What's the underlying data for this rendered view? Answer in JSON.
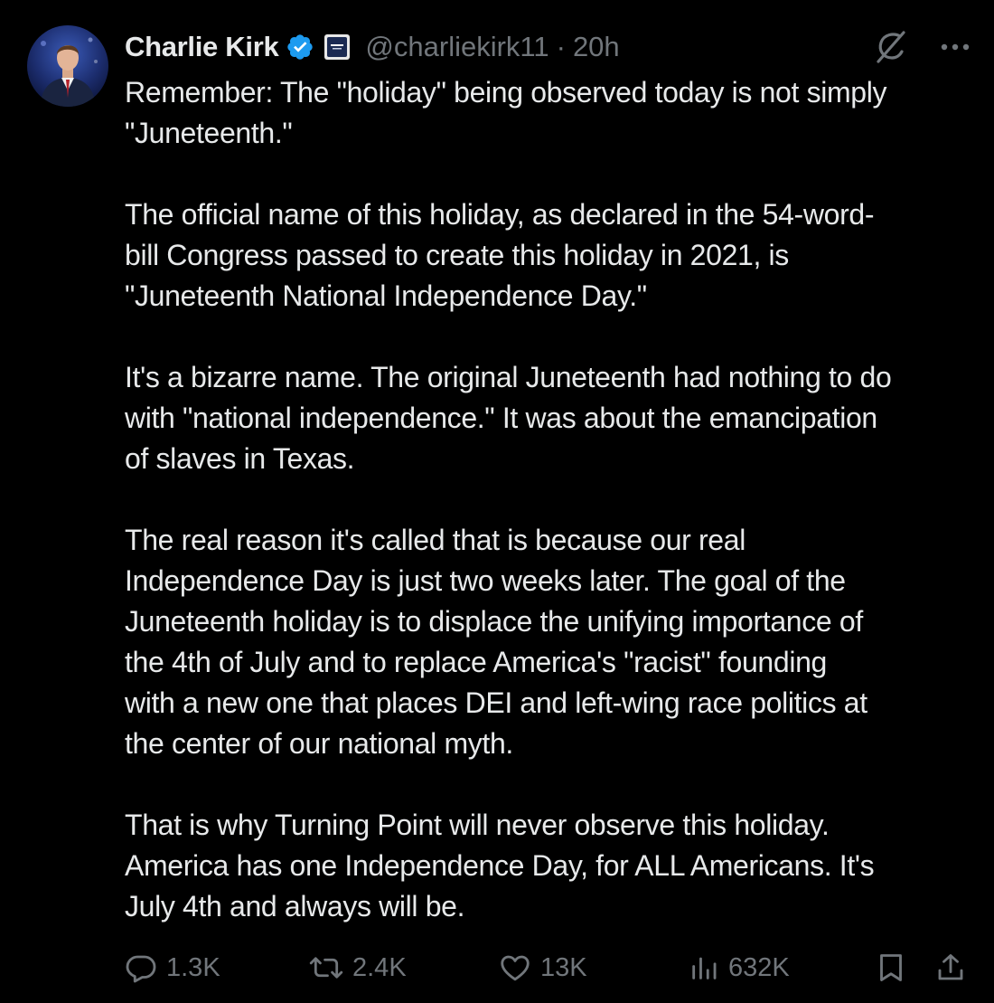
{
  "author": {
    "display_name": "Charlie Kirk",
    "handle": "@charliekirk11",
    "separator": "·",
    "time": "20h",
    "verified_icon": "verified-badge-icon",
    "affiliation_icon": "affiliation-badge-icon"
  },
  "tweet": {
    "text": "Remember: The \"holiday\" being observed today is not simply\n\"Juneteenth.\"\n\nThe official name of this holiday, as declared in the 54-word-\nbill Congress passed to create this holiday in 2021, is\n\"Juneteenth National Independence Day.\"\n\nIt's a bizarre name. The original Juneteenth had nothing to do\nwith \"national independence.\" It was about the emancipation\nof slaves in Texas.\n\nThe real reason it's called that is because our real\nIndependence Day is just two weeks later. The goal of the\nJuneteenth holiday is to displace the unifying importance of\nthe 4th of July and to replace America's \"racist\" founding\nwith a new one that places DEI and left-wing race politics at\nthe center of our national myth.\n\nThat is why Turning Point will never observe this holiday.\nAmerica has one Independence Day, for ALL Americans. It's\nJuly 4th and always will be."
  },
  "actions": {
    "replies": "1.3K",
    "reposts": "2.4K",
    "likes": "13K",
    "views": "632K"
  },
  "colors": {
    "background": "#000000",
    "text": "#e7e9ea",
    "muted": "#71767b",
    "verified": "#1d9bf0"
  }
}
